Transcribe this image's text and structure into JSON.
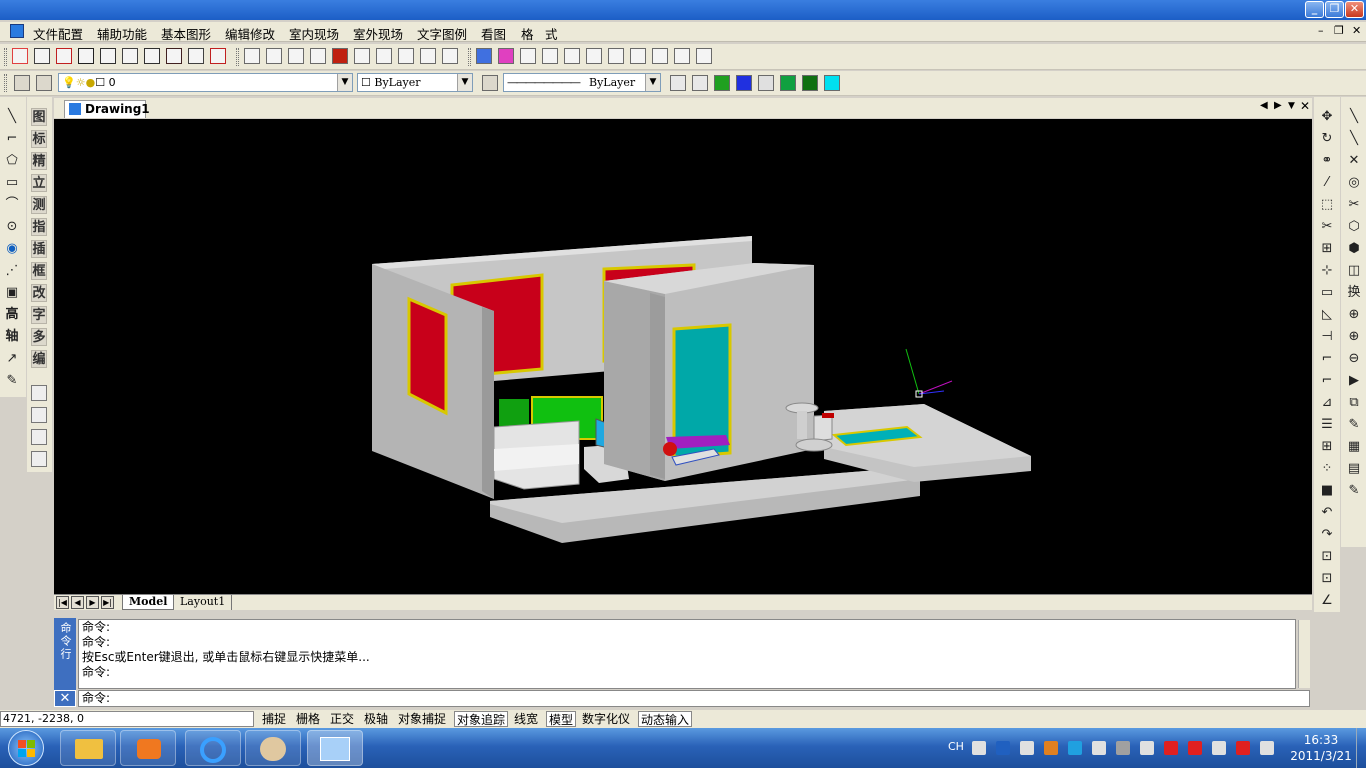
{
  "window": {
    "minimize": "_",
    "restore": "❐",
    "close": "✕"
  },
  "menu": [
    "文件配置",
    "辅助功能",
    "基本图形",
    "编辑修改",
    "室内现场",
    "室外现场",
    "文字图例",
    "看图",
    "格",
    "式"
  ],
  "mdi_controls": {
    "minimize": "–",
    "restore": "❐",
    "close": "✕"
  },
  "layer_toolbar": {
    "layer_value": "0",
    "color_value": "ByLayer",
    "linetype_value": "ByLayer"
  },
  "left_char_tools": [
    "图",
    "标",
    "精",
    "立",
    "测",
    "指",
    "插",
    "框",
    "改",
    "字",
    "多",
    "编"
  ],
  "left_icon_tools": [
    "line-icon",
    "polyline-icon",
    "polygon-icon",
    "rectangle-icon",
    "arc-icon",
    "circle-icon",
    "view-icon",
    "hatch-icon",
    "box-icon",
    "高",
    "轴",
    "dimension-icon",
    "eyedropper-icon"
  ],
  "tabs": {
    "document": "Drawing1",
    "nav_prev": "◀",
    "nav_next": "▶",
    "nav_menu": "▼",
    "close": "✕"
  },
  "layout_tabs": [
    "Model",
    "Layout1"
  ],
  "command": {
    "side_label": "命令行",
    "history": [
      "命令:",
      "命令:",
      "按Esc或Enter键退出, 或单击鼠标右键显示快捷菜单...",
      "命令:"
    ],
    "prompt": "命令:"
  },
  "status": {
    "coords": "4721, -2238, 0",
    "buttons": [
      {
        "label": "捕捉",
        "on": false
      },
      {
        "label": "栅格",
        "on": false
      },
      {
        "label": "正交",
        "on": false
      },
      {
        "label": "极轴",
        "on": false
      },
      {
        "label": "对象捕捉",
        "on": false
      },
      {
        "label": "对象追踪",
        "on": true
      },
      {
        "label": "线宽",
        "on": false
      },
      {
        "label": "模型",
        "on": true
      },
      {
        "label": "数字化仪",
        "on": false
      },
      {
        "label": "动态输入",
        "on": true
      }
    ]
  },
  "taskbar": {
    "lang": "CH",
    "time": "16:33",
    "date": "2011/3/21"
  },
  "colors": {
    "title": "#1c5ec6",
    "canvas": "#000000",
    "wall": "#c9c9c9",
    "red_panel": "#c8001a",
    "door": "#00a8a8",
    "frame": "#d8c800",
    "green_cabinet": "#10c010"
  }
}
